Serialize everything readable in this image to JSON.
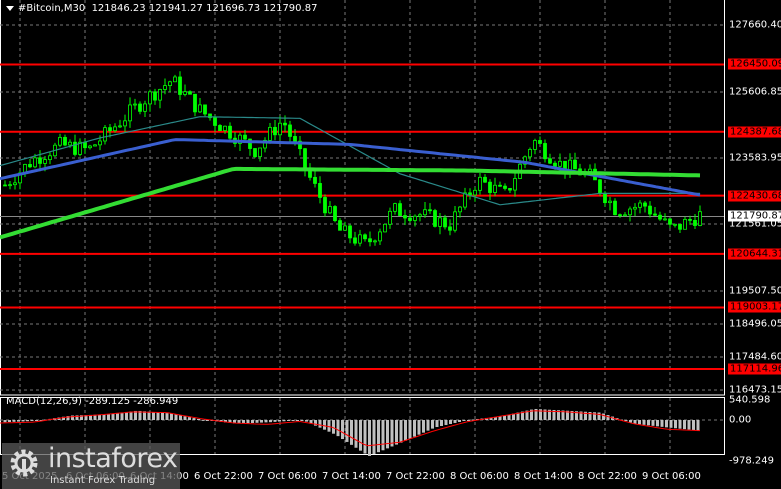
{
  "header": {
    "symbol": "#Bitcoin,M30",
    "open": "121846.23",
    "high": "121941.27",
    "low": "121696.73",
    "close": "121790.87"
  },
  "macd": {
    "label": "MACD(12,26,9)",
    "main": "-289.125",
    "signal": "-286.949",
    "scale_top": "540.598",
    "scale_zero": "0.00",
    "scale_bottom": "-978.249"
  },
  "price_axis": [
    "127660.40",
    "125606.85",
    "123583.95",
    "121561.05",
    "119507.50",
    "118496.05",
    "117484.60",
    "116473.15"
  ],
  "levels": [
    "126450.09",
    "124387.68",
    "122430.68",
    "120644.31",
    "119003.17",
    "117114.96"
  ],
  "current_price": "121790.87",
  "time_axis": [
    "5 Oct 2025",
    "6 Oct 06:00",
    "6 Oct 14:00",
    "6 Oct 22:00",
    "7 Oct 06:00",
    "7 Oct 14:00",
    "7 Oct 22:00",
    "8 Oct 06:00",
    "8 Oct 14:00",
    "8 Oct 22:00",
    "9 Oct 06:00"
  ],
  "logo": {
    "name": "instaforex",
    "tagline": "Instant Forex Trading"
  },
  "colors": {
    "bull": "#00ff00",
    "bear": "#00ff00",
    "level": "#ff0000",
    "ma_fast": "#2a8a8a",
    "ma_mid": "#3a5fd0",
    "ma_slow": "#33dd33",
    "macd_hist": "#c0c0c0",
    "macd_signal": "#ff0000"
  },
  "chart_data": {
    "type": "candlestick",
    "price_range": [
      116473.15,
      128200
    ],
    "close_path": [
      122757,
      123523,
      123983,
      123830,
      124595,
      125362,
      125975,
      125055,
      124443,
      123830,
      124750,
      122910,
      121378,
      120920,
      121990,
      121838,
      121531,
      122910,
      122450,
      124136,
      123370,
      123063,
      121990,
      122143,
      121378,
      121838
    ],
    "ma_slow": [
      121150,
      123250,
      123200,
      123050
    ],
    "ma_mid": [
      122950,
      124150,
      124000,
      123450,
      122450
    ],
    "ma_fast": [
      123350,
      124200,
      124850,
      124800,
      123100,
      122150,
      122500,
      122500
    ],
    "macd_hist": [
      -60,
      -20,
      120,
      150,
      250,
      180,
      0,
      -100,
      -60,
      0,
      -400,
      -978,
      -600,
      -200,
      0,
      100,
      300,
      250,
      200,
      -100,
      -200,
      -289
    ],
    "macd_signal": [
      -80,
      -60,
      80,
      140,
      220,
      200,
      40,
      -80,
      -120,
      -40,
      -200,
      -700,
      -600,
      -300,
      -50,
      100,
      250,
      220,
      150,
      -100,
      -250,
      -287
    ]
  }
}
